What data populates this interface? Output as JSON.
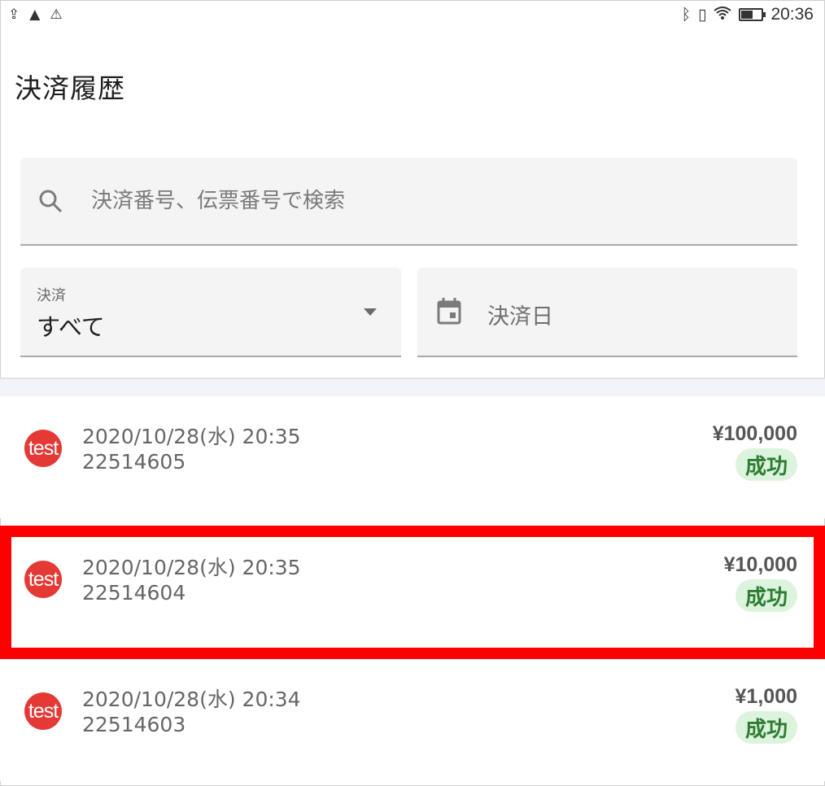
{
  "status_bar": {
    "time": "20:36"
  },
  "page": {
    "title": "決済履歴"
  },
  "search": {
    "placeholder": "決済番号、伝票番号で検索",
    "value": ""
  },
  "filters": {
    "payment_label": "決済",
    "payment_value": "すべて",
    "date_placeholder": "決済日"
  },
  "transactions": [
    {
      "avatar": "test",
      "datetime": "2020/10/28(水) 20:35",
      "number": "22514605",
      "amount": "¥100,000",
      "status": "成功"
    },
    {
      "avatar": "test",
      "datetime": "2020/10/28(水) 20:35",
      "number": "22514604",
      "amount": "¥10,000",
      "status": "成功"
    },
    {
      "avatar": "test",
      "datetime": "2020/10/28(水) 20:34",
      "number": "22514603",
      "amount": "¥1,000",
      "status": "成功"
    }
  ],
  "colors": {
    "avatar": "#e53935",
    "status_bg": "#dcf3dd",
    "status_text": "#2e7d32",
    "highlight": "#ff0000"
  },
  "icons": [
    "upload-icon",
    "lock-icon",
    "warning-icon",
    "bluetooth-icon",
    "vibrate-icon",
    "wifi-icon",
    "battery-icon",
    "search-icon",
    "calendar-icon",
    "dropdown-arrow-icon"
  ]
}
